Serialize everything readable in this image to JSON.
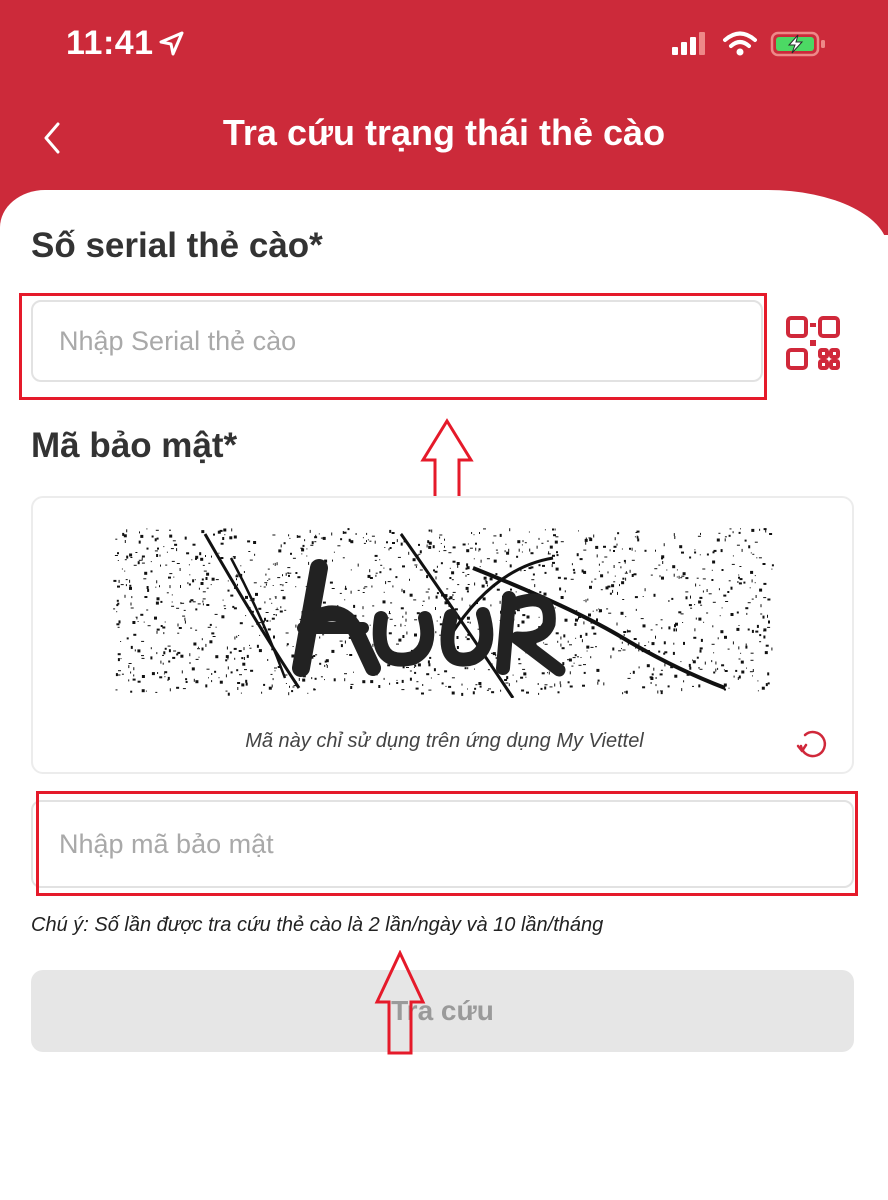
{
  "status_bar": {
    "time": "11:41"
  },
  "header": {
    "title": "Tra cứu trạng thái thẻ cào"
  },
  "serial": {
    "label": "Số serial thẻ cào*",
    "placeholder": "Nhập Serial thẻ cào"
  },
  "security": {
    "label": "Mã bảo mật*",
    "captcha_note": "Mã này chỉ sử dụng trên ứng dụng My Viettel",
    "placeholder": "Nhập mã bảo mật"
  },
  "note": "Chú ý: Số lần được tra cứu thẻ cào là 2 lần/ngày và 10 lần/tháng",
  "submit_label": "Tra cứu",
  "colors": {
    "brand": "#cc2a3a",
    "highlight": "#e51a2a"
  },
  "icons": [
    "location-arrow-icon",
    "cellular-signal-icon",
    "wifi-icon",
    "battery-charging-icon",
    "back-chevron-icon",
    "qr-code-icon",
    "refresh-icon",
    "up-arrow-icon"
  ]
}
